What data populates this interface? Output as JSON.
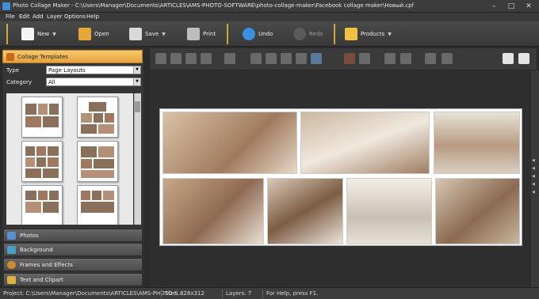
{
  "window": {
    "title": "Photo Collage Maker - C:\\Users\\Manager\\Documents\\ARTICLES\\AMS-PHOTO-SOFTWARE\\photo-collage-maker\\Facebook collage maker\\Новый.cpf",
    "min": "–",
    "max": "□",
    "close": "✕"
  },
  "menu": [
    "File",
    "Edit",
    "Add",
    "Layer",
    "Options",
    "Help"
  ],
  "toolbar": {
    "new": "New",
    "open": "Open",
    "save": "Save",
    "print": "Print",
    "undo": "Undo",
    "redo": "Redo",
    "products": "Products"
  },
  "left_panel": {
    "header": "Collage Templates",
    "type_label": "Type",
    "type_value": "Page Layouts",
    "category_label": "Category",
    "category_value": "All",
    "categories": [
      "Photos",
      "Background",
      "Frames and Effects",
      "Text and Clipart"
    ]
  },
  "colors": {
    "accent": "#e7a23d",
    "separator": "#d4a838",
    "panel": "#353535",
    "canvas": "#2e2e2e"
  },
  "status": {
    "path": "Project: C:\\Users\\Manager\\Documents\\ARTICLES\\AMS-PHOTO-S...",
    "size": "Size: 828x312",
    "layers": "Layers: 7",
    "help": "For Help, press F1."
  }
}
